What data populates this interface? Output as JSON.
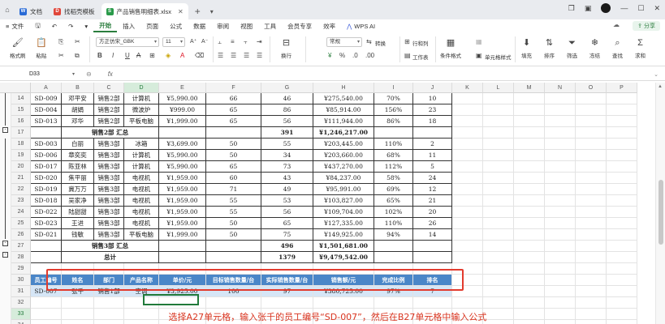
{
  "tabs": [
    {
      "label": "文档",
      "color": "#2a6bd6",
      "glyph": "W",
      "active": false
    },
    {
      "label": "找稻壳模板",
      "color": "#e0463a",
      "glyph": "D",
      "active": false
    },
    {
      "label": "产品销售明细表.xlsx",
      "color": "#2a9a4a",
      "glyph": "S",
      "active": true
    }
  ],
  "menu": {
    "file": "文件",
    "items": [
      "开始",
      "插入",
      "页面",
      "公式",
      "数据",
      "审阅",
      "视图",
      "工具",
      "会员专享",
      "效率"
    ],
    "active_index": 0,
    "wps_ai": "WPS AI",
    "share": "分享"
  },
  "ribbon": {
    "format_painter": "格式刷",
    "paste": "粘贴",
    "font_name": "方正仿宋_GBK",
    "font_size": "11",
    "number_format": "常规",
    "wrap": "换行",
    "convert": "转换",
    "row_col": "行和列",
    "worksheet": "工作表",
    "cond_format": "条件格式",
    "cell_style": "单元格样式",
    "fill": "填充",
    "sort": "排序",
    "filter": "筛选",
    "freeze": "冻结",
    "find": "查找",
    "sum": "求和"
  },
  "formula_bar": {
    "name_box": "D33",
    "fx": "fx"
  },
  "columns": [
    "A",
    "B",
    "C",
    "D",
    "E",
    "F",
    "G",
    "H",
    "I",
    "J",
    "K",
    "L",
    "M",
    "N",
    "O",
    "P"
  ],
  "selected_column": "D",
  "selected_row": "33",
  "rows": [
    {
      "n": "14",
      "cells": [
        "SD-009",
        "邓平安",
        "销售2部",
        "计算机",
        "¥5,990.00",
        "66",
        "46",
        "¥275,540.00",
        "70%",
        "10"
      ]
    },
    {
      "n": "15",
      "cells": [
        "SD-004",
        "胡娟",
        "销售2部",
        "微波炉",
        "¥999.00",
        "65",
        "86",
        "¥85,914.00",
        "156%",
        "23"
      ]
    },
    {
      "n": "16",
      "cells": [
        "SD-013",
        "邓华",
        "销售2部",
        "平板电脑",
        "¥1,999.00",
        "65",
        "56",
        "¥111,944.00",
        "86%",
        "18"
      ]
    },
    {
      "n": "17",
      "cells": [
        "",
        "销售2部 汇总",
        "",
        "",
        "",
        "",
        "391",
        "¥1,246,217.00",
        "",
        ""
      ],
      "summary": true
    },
    {
      "n": "18",
      "cells": [
        "SD-003",
        "白丽",
        "销售3部",
        "冰箱",
        "¥3,699.00",
        "50",
        "55",
        "¥203,445.00",
        "110%",
        "2"
      ]
    },
    {
      "n": "19",
      "cells": [
        "SD-006",
        "章奕奕",
        "销售3部",
        "计算机",
        "¥5,990.00",
        "50",
        "34",
        "¥203,660.00",
        "68%",
        "11"
      ]
    },
    {
      "n": "20",
      "cells": [
        "SD-017",
        "陈亚林",
        "销售3部",
        "计算机",
        "¥5,990.00",
        "65",
        "73",
        "¥437,270.00",
        "112%",
        "5"
      ]
    },
    {
      "n": "21",
      "cells": [
        "SD-020",
        "焦平丽",
        "销售3部",
        "电视机",
        "¥1,959.00",
        "60",
        "43",
        "¥84,237.00",
        "58%",
        "24"
      ]
    },
    {
      "n": "22",
      "cells": [
        "SD-019",
        "冀万万",
        "销售3部",
        "电视机",
        "¥1,959.00",
        "71",
        "49",
        "¥95,991.00",
        "69%",
        "12"
      ]
    },
    {
      "n": "23",
      "cells": [
        "SD-018",
        "吴家净",
        "销售3部",
        "电视机",
        "¥1,959.00",
        "55",
        "53",
        "¥103,827.00",
        "65%",
        "21"
      ]
    },
    {
      "n": "24",
      "cells": [
        "SD-022",
        "陆甜甜",
        "销售3部",
        "电视机",
        "¥1,959.00",
        "55",
        "56",
        "¥109,704.00",
        "102%",
        "20"
      ]
    },
    {
      "n": "25",
      "cells": [
        "SD-023",
        "王进",
        "销售3部",
        "电视机",
        "¥1,959.00",
        "50",
        "65",
        "¥127,335.00",
        "110%",
        "26"
      ]
    },
    {
      "n": "26",
      "cells": [
        "SD-021",
        "钱敏",
        "销售3部",
        "平板电脑",
        "¥1,999.00",
        "50",
        "75",
        "¥149,925.00",
        "94%",
        "14"
      ]
    },
    {
      "n": "27",
      "cells": [
        "",
        "销售3部 汇总",
        "",
        "",
        "",
        "",
        "496",
        "¥1,501,681.00",
        "",
        ""
      ],
      "summary": true
    },
    {
      "n": "28",
      "cells": [
        "",
        "总计",
        "",
        "",
        "",
        "",
        "1379",
        "¥9,479,542.00",
        "",
        ""
      ],
      "summary": true
    },
    {
      "n": "29",
      "cells": [
        "",
        "",
        "",
        "",
        "",
        "",
        "",
        "",
        "",
        ""
      ]
    },
    {
      "n": "30",
      "cells": [
        "员工编号",
        "姓名",
        "部门",
        "产品名称",
        "单价/元",
        "目标销售数量/台",
        "实际销售数量/台",
        "销售额/元",
        "完成比例",
        "排名"
      ],
      "header": true
    },
    {
      "n": "31",
      "cells": [
        "SD-007",
        "张千",
        "销售1部",
        "空调",
        "¥3,925.00",
        "100",
        "97",
        "¥380,725.00",
        "97%",
        "7"
      ],
      "lookup": true
    },
    {
      "n": "32",
      "cells": [
        "",
        "",
        "",
        "",
        "",
        "",
        "",
        "",
        "",
        ""
      ]
    },
    {
      "n": "33",
      "cells": [
        "",
        "",
        "",
        "",
        "",
        "",
        "",
        "",
        "",
        ""
      ]
    },
    {
      "n": "34",
      "cells": [
        "",
        "",
        "",
        "",
        "",
        "",
        "",
        "",
        "",
        ""
      ]
    }
  ],
  "caption": "选择A27单元格，输入张千的员工编号“SD-007”，然后在B27单元格中输入公式"
}
